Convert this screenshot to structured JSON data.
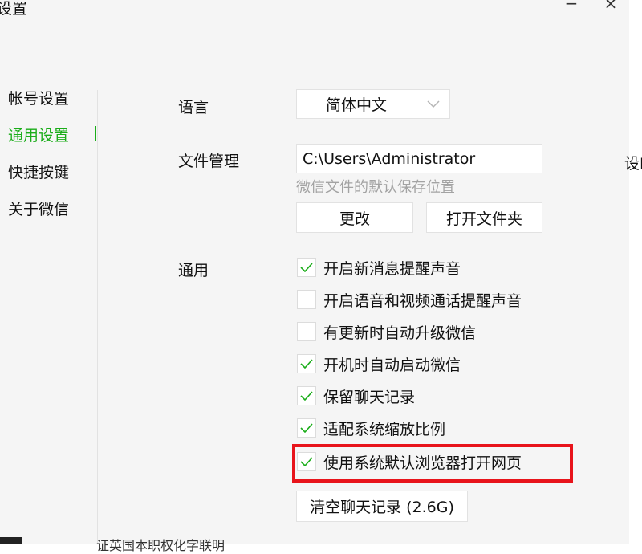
{
  "window": {
    "title": "设置",
    "minimize_glyph": "−",
    "close_glyph": "×"
  },
  "sidebar": {
    "items": [
      {
        "label": "帐号设置",
        "active": false
      },
      {
        "label": "通用设置",
        "active": true
      },
      {
        "label": "快捷按键",
        "active": false
      },
      {
        "label": "关于微信",
        "active": false
      }
    ]
  },
  "language": {
    "label": "语言",
    "selected": "简体中文"
  },
  "file_management": {
    "label": "文件管理",
    "path_value": "C:\\Users\\Administrator",
    "hint": "微信文件的默认保存位置",
    "change_button": "更改",
    "open_folder_button": "打开文件夹",
    "cut_off_text": "设I"
  },
  "general": {
    "label": "通用",
    "options": [
      {
        "label": "开启新消息提醒声音",
        "checked": true
      },
      {
        "label": "开启语音和视频通话提醒声音",
        "checked": false
      },
      {
        "label": "有更新时自动升级微信",
        "checked": false
      },
      {
        "label": "开机时自动启动微信",
        "checked": true
      },
      {
        "label": "保留聊天记录",
        "checked": true
      },
      {
        "label": "适配系统缩放比例",
        "checked": true
      },
      {
        "label": "使用系统默认浏览器打开网页",
        "checked": true
      }
    ],
    "clear_history_button": "清空聊天记录 (2.6G)"
  },
  "footer": {
    "cut_off_text": "证英国本职权化字联明"
  },
  "colors": {
    "accent": "#1aad19",
    "highlight": "#e8141b",
    "hint": "#a3a3a3"
  },
  "icons": {
    "checkmark": "check-icon",
    "dropdown_arrow": "chevron-down-icon"
  }
}
